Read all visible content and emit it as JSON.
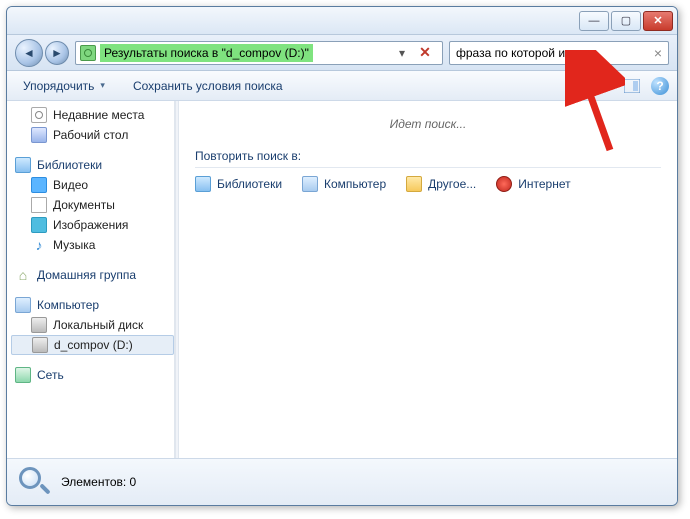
{
  "titlebar": {
    "minimize": "—",
    "maximize": "▢",
    "close": "✕"
  },
  "nav": {
    "back": "◄",
    "forward": "►",
    "address_label": "Результаты поиска в \"d_compov (D:)\"",
    "dropdown": "▾",
    "stop": "✕",
    "search_value": "фраза по которой искать",
    "clear": "×"
  },
  "cmdbar": {
    "organize": "Упорядочить",
    "save_search": "Сохранить условия поиска",
    "help": "?"
  },
  "sidebar": {
    "favorites": [
      {
        "icon": "recent",
        "label": "Недавние места"
      },
      {
        "icon": "desk",
        "label": "Рабочий стол"
      }
    ],
    "libraries_head": "Библиотеки",
    "libraries": [
      {
        "icon": "video",
        "label": "Видео"
      },
      {
        "icon": "doc",
        "label": "Документы"
      },
      {
        "icon": "img",
        "label": "Изображения"
      },
      {
        "icon": "music",
        "glyph": "♪",
        "label": "Музыка"
      }
    ],
    "homegroup": "Домашняя группа",
    "computer_head": "Компьютер",
    "computer": [
      {
        "icon": "disk",
        "label": "Локальный диск"
      },
      {
        "icon": "disk",
        "label": "d_compov (D:)",
        "selected": true
      }
    ],
    "network_head": "Сеть"
  },
  "content": {
    "searching": "Идет поиск...",
    "repeat_head": "Повторить поиск в:",
    "scopes": [
      {
        "icon": "lib",
        "label": "Библиотеки"
      },
      {
        "icon": "pc",
        "label": "Компьютер"
      },
      {
        "icon": "folder",
        "label": "Другое..."
      },
      {
        "icon": "opera",
        "label": "Интернет"
      }
    ]
  },
  "statusbar": {
    "elements_label": "Элементов: 0"
  }
}
